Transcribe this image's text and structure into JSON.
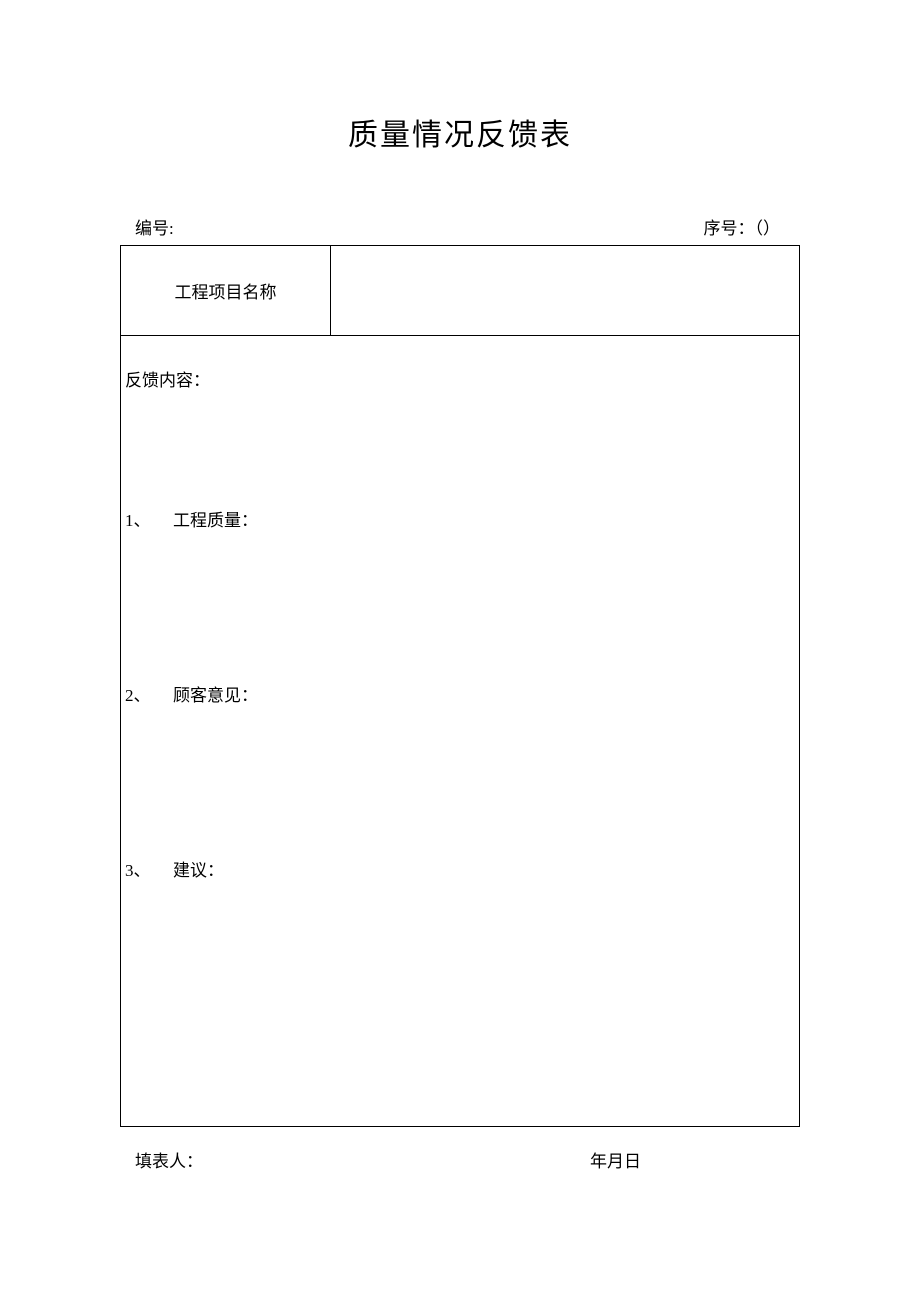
{
  "title": "质量情况反馈表",
  "header": {
    "left_label": "编号:",
    "right_label": "序号：（）"
  },
  "row1": {
    "label": "工程项目名称",
    "value": ""
  },
  "feedback": {
    "label": "反馈内容：",
    "items": [
      {
        "num": "1、",
        "label": "工程质量："
      },
      {
        "num": "2、",
        "label": "顾客意见："
      },
      {
        "num": "3、",
        "label": "建议："
      }
    ]
  },
  "footer": {
    "left_label": "填表人：",
    "right_label": "年月日"
  }
}
